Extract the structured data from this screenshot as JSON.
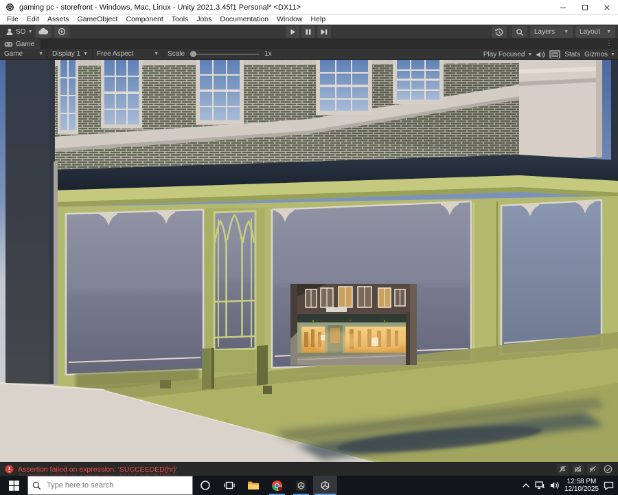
{
  "window": {
    "title": "gaming pc - storefront - Windows, Mac, Linux - Unity 2021.3.45f1 Personal* <DX11>"
  },
  "menubar": {
    "items": [
      "File",
      "Edit",
      "Assets",
      "GameObject",
      "Component",
      "Tools",
      "Jobs",
      "Documentation",
      "Window",
      "Help"
    ]
  },
  "toolbar": {
    "account_label": "SO",
    "layers_label": "Layers",
    "layout_label": "Layout"
  },
  "tabbar": {
    "game_label": "Game",
    "overflow_glyph": "⋮"
  },
  "game_view_toolbar": {
    "view": "Game",
    "display": "Display 1",
    "aspect": "Free Aspect",
    "scale_label": "Scale",
    "scale_value": "1x",
    "play_focused": "Play Focused",
    "stats": "Stats",
    "gizmos": "Gizmos"
  },
  "status_bar": {
    "message": "Assertion failed on expression: 'SUCCEEDED(hr)'"
  },
  "taskbar": {
    "search_placeholder": "Type here to search",
    "time": "12:58 PM",
    "date": "12/10/2025"
  },
  "scene": {
    "colors": {
      "sky_top": "#4b69a3",
      "sky_horizon": "#c2c8d2",
      "brick": "#5e6350",
      "mortar": "#c9c2ba",
      "trim_cream": "#d6cfc8",
      "fascia_navy": "#232b39",
      "storefront_green": "#b3b96e",
      "storefront_green_light": "#c5c97d",
      "shop_glass": "#7c7f93",
      "upper_glass": "#7d9cc7",
      "sidewalk": "#d9d3cb",
      "ground_olive": "#aeb166",
      "shadow": "#3a474f",
      "error_red": "#ef4d46",
      "taskbar_accent": "#4a8fd4"
    }
  }
}
